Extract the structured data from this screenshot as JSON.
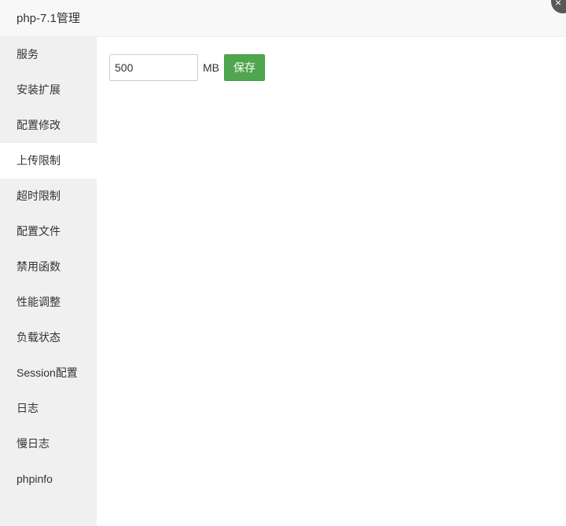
{
  "window": {
    "title": "php-7.1管理",
    "close_label": "×"
  },
  "sidebar": {
    "active_index": 3,
    "items": [
      {
        "label": "服务"
      },
      {
        "label": "安装扩展"
      },
      {
        "label": "配置修改"
      },
      {
        "label": "上传限制"
      },
      {
        "label": "超时限制"
      },
      {
        "label": "配置文件"
      },
      {
        "label": "禁用函数"
      },
      {
        "label": "性能调整"
      },
      {
        "label": "负载状态"
      },
      {
        "label": "Session配置"
      },
      {
        "label": "日志"
      },
      {
        "label": "慢日志"
      },
      {
        "label": "phpinfo"
      }
    ]
  },
  "upload_limit": {
    "value": "500",
    "unit": "MB",
    "save_label": "保存"
  },
  "colors": {
    "save_button": "#4fa64e",
    "sidebar_bg": "#f0f0f0",
    "title_bg": "#f8f8f8"
  }
}
